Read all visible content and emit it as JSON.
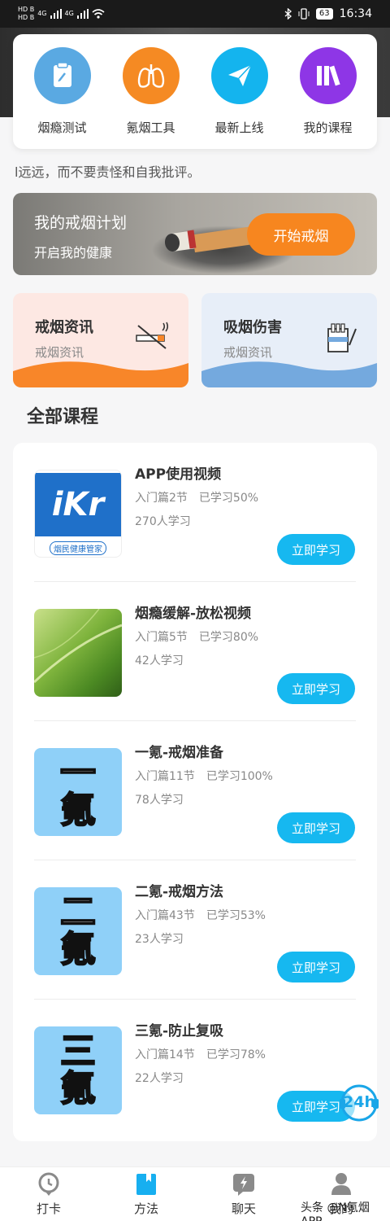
{
  "status_bar": {
    "left_1": "HD B",
    "left_2": "HD B",
    "net_1": "4G",
    "net_2": "4G",
    "battery": "63",
    "time": "16:34"
  },
  "quick_menu": [
    {
      "label": "烟瘾测试",
      "icon": "test-tube-icon",
      "color": "#5aa9e2"
    },
    {
      "label": "氪烟工具",
      "icon": "lungs-icon",
      "color": "#f58a23"
    },
    {
      "label": "最新上线",
      "icon": "paper-plane-icon",
      "color": "#14b4ee"
    },
    {
      "label": "我的课程",
      "icon": "books-icon",
      "color": "#8e36e6"
    }
  ],
  "marquee_text": "l远远，而不要责怪和自我批评。",
  "plan_banner": {
    "title": "我的戒烟计划",
    "subtitle": "开启我的健康",
    "button": "开始戒烟"
  },
  "info_cards": [
    {
      "title": "戒烟资讯",
      "subtitle": "戒烟资讯",
      "bg": "#fde8e3",
      "wave": "#f88629"
    },
    {
      "title": "吸烟伤害",
      "subtitle": "戒烟资讯",
      "bg": "#e7eef8",
      "wave": "#74a9de"
    }
  ],
  "section_title": "全部课程",
  "courses": [
    {
      "title": "APP使用视频",
      "lessons": "入门篇2节",
      "progress": "已学习50%",
      "learners": "270人学习",
      "button": "立即学习",
      "thumb_text_1": "iKr",
      "thumb_text_2": "烟民健康管家"
    },
    {
      "title": "烟瘾缓解-放松视频",
      "lessons": "入门篇5节",
      "progress": "已学习80%",
      "learners": "42人学习",
      "button": "立即学习"
    },
    {
      "title": "一氪-戒烟准备",
      "lessons": "入门篇11节",
      "progress": "已学习100%",
      "learners": "78人学习",
      "button": "立即学习",
      "thumb_text_1": "一",
      "thumb_text_2": "氪"
    },
    {
      "title": "二氪-戒烟方法",
      "lessons": "入门篇43节",
      "progress": "已学习53%",
      "learners": "23人学习",
      "button": "立即学习",
      "thumb_text_1": "二",
      "thumb_text_2": "氪"
    },
    {
      "title": "三氪-防止复吸",
      "lessons": "入门篇14节",
      "progress": "已学习78%",
      "learners": "22人学习",
      "button": "立即学习",
      "thumb_text_1": "三",
      "thumb_text_2": "氪"
    }
  ],
  "float_badge": "24h",
  "tabs": [
    {
      "label": "打卡",
      "icon": "clock-pin-icon"
    },
    {
      "label": "方法",
      "icon": "book-icon"
    },
    {
      "label": "聊天",
      "icon": "chat-bolt-icon"
    },
    {
      "label": "我的",
      "icon": "person-icon"
    }
  ],
  "watermark": "头条 @N氪烟APP"
}
